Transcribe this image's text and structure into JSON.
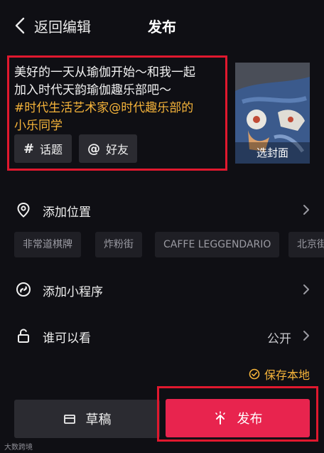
{
  "header": {
    "back_label": "返回编辑",
    "title": "发布"
  },
  "caption": {
    "plain_lines": [
      "美好的一天从瑜伽开始～和我一起",
      "加入时代天韵瑜伽趣乐部吧～"
    ],
    "tag_lines": [
      "#时代生活艺术家@时代趣乐部的",
      "小乐同学"
    ]
  },
  "chips": {
    "topic": "话题",
    "friend": "好友",
    "topic_glyph": "#",
    "friend_glyph": "@"
  },
  "cover": {
    "label": "选封面"
  },
  "location": {
    "label": "添加位置",
    "suggestions": [
      "非常道棋牌",
      "炸粉街",
      "CAFFE LEGGENDARIO",
      "北京街"
    ]
  },
  "mini_program": {
    "label": "添加小程序"
  },
  "visibility": {
    "label": "谁可以看",
    "value": "公开"
  },
  "save_local": {
    "label": "保存本地"
  },
  "actions": {
    "draft": "草稿",
    "publish": "发布"
  },
  "watermark": "大数跨境",
  "colors": {
    "accent_tag": "#f6b43a",
    "publish": "#e8244e",
    "highlight_border": "#e0182e"
  }
}
